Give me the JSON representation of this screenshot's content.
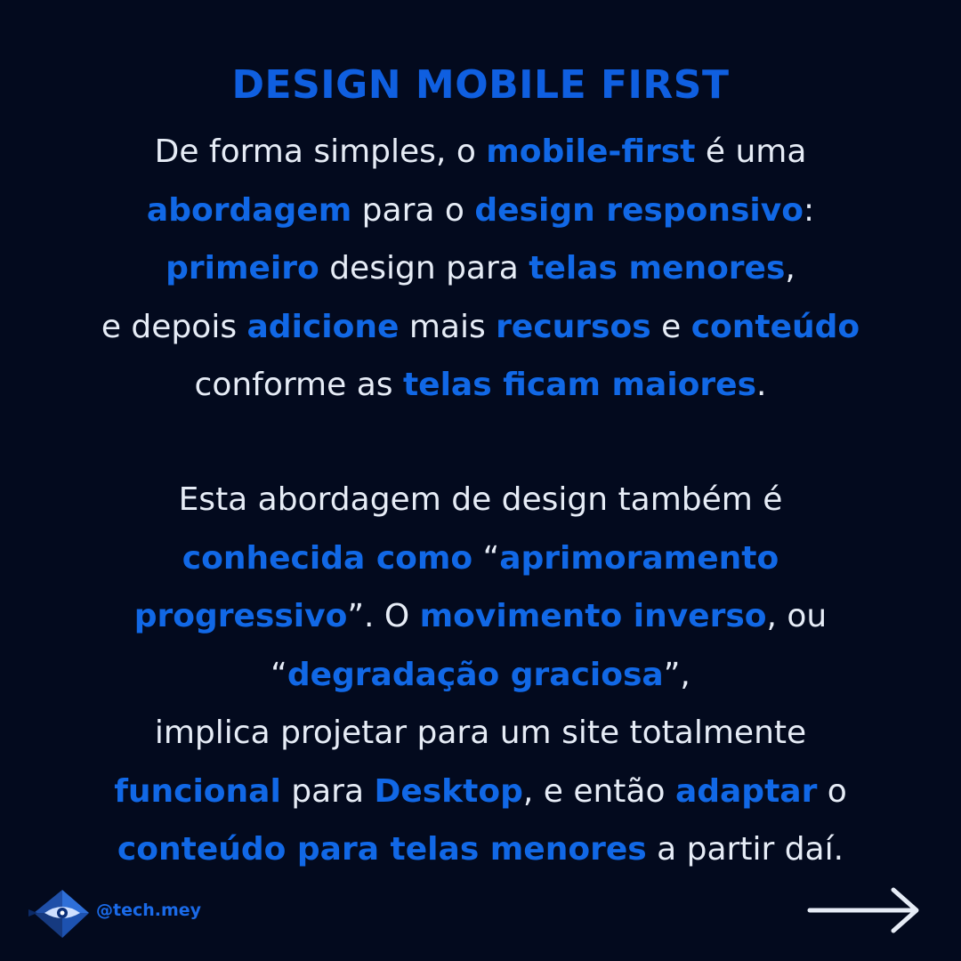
{
  "title": "DESIGN MOBILE FIRST",
  "paragraph1": [
    [
      {
        "t": "De forma simples, o ",
        "hl": false
      },
      {
        "t": "mobile-first",
        "hl": true
      },
      {
        "t": " é uma",
        "hl": false
      }
    ],
    [
      {
        "t": "abordagem",
        "hl": true
      },
      {
        "t": " para o ",
        "hl": false
      },
      {
        "t": "design responsivo",
        "hl": true
      },
      {
        "t": ":",
        "hl": false
      }
    ],
    [
      {
        "t": "primeiro",
        "hl": true
      },
      {
        "t": " design para ",
        "hl": false
      },
      {
        "t": "telas menores",
        "hl": true
      },
      {
        "t": ",",
        "hl": false
      }
    ],
    [
      {
        "t": "e depois ",
        "hl": false
      },
      {
        "t": "adicione",
        "hl": true
      },
      {
        "t": " mais ",
        "hl": false
      },
      {
        "t": "recursos",
        "hl": true
      },
      {
        "t": " e ",
        "hl": false
      },
      {
        "t": "conteúdo",
        "hl": true
      }
    ],
    [
      {
        "t": "conforme as ",
        "hl": false
      },
      {
        "t": "telas ficam maiores",
        "hl": true
      },
      {
        "t": ".",
        "hl": false
      }
    ]
  ],
  "paragraph2": [
    [
      {
        "t": "Esta abordagem de design também é",
        "hl": false
      }
    ],
    [
      {
        "t": "conhecida como",
        "hl": true
      },
      {
        "t": " “",
        "hl": false
      },
      {
        "t": "aprimoramento",
        "hl": true
      }
    ],
    [
      {
        "t": "progressivo",
        "hl": true
      },
      {
        "t": "”. O ",
        "hl": false
      },
      {
        "t": "movimento inverso",
        "hl": true
      },
      {
        "t": ", ou",
        "hl": false
      }
    ],
    [
      {
        "t": "“",
        "hl": false
      },
      {
        "t": "degradação graciosa",
        "hl": true
      },
      {
        "t": "”,",
        "hl": false
      }
    ],
    [
      {
        "t": "implica projetar para um site totalmente",
        "hl": false
      }
    ],
    [
      {
        "t": "funcional",
        "hl": true
      },
      {
        "t": " para ",
        "hl": false
      },
      {
        "t": "Desktop",
        "hl": true
      },
      {
        "t": ", e então ",
        "hl": false
      },
      {
        "t": "adaptar",
        "hl": true
      },
      {
        "t": " o",
        "hl": false
      }
    ],
    [
      {
        "t": "conteúdo para telas menores",
        "hl": true
      },
      {
        "t": " a partir daí.",
        "hl": false
      }
    ]
  ],
  "footer": {
    "handle": "@tech.mey",
    "logo_icon": "diamond-eye-logo-icon",
    "next_icon": "arrow-right-icon"
  },
  "colors": {
    "background": "#030a1e",
    "accent": "#1168e6",
    "text": "#e6ecf6"
  }
}
